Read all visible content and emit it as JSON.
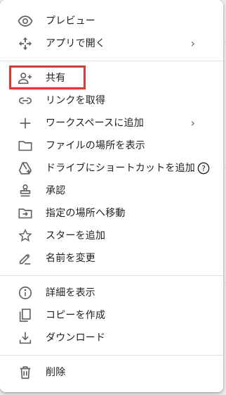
{
  "menu": {
    "group1": [
      {
        "label": "プレビュー",
        "icon": "eye-icon"
      },
      {
        "label": "アプリで開く",
        "icon": "move-arrows-icon",
        "submenu": true
      }
    ],
    "group2": [
      {
        "label": "共有",
        "icon": "person-add-icon"
      },
      {
        "label": "リンクを取得",
        "icon": "link-icon"
      },
      {
        "label": "ワークスペースに追加",
        "icon": "plus-icon",
        "submenu": true
      },
      {
        "label": "ファイルの場所を表示",
        "icon": "folder-icon"
      },
      {
        "label": "ドライブにショートカットを追加",
        "icon": "drive-shortcut-icon",
        "help": "?"
      },
      {
        "label": "承認",
        "icon": "stamp-icon"
      },
      {
        "label": "指定の場所へ移動",
        "icon": "folder-move-icon"
      },
      {
        "label": "スターを追加",
        "icon": "star-icon"
      },
      {
        "label": "名前を変更",
        "icon": "pencil-icon"
      }
    ],
    "group3": [
      {
        "label": "詳細を表示",
        "icon": "info-icon"
      },
      {
        "label": "コピーを作成",
        "icon": "copy-icon"
      },
      {
        "label": "ダウンロード",
        "icon": "download-icon"
      }
    ],
    "group4": [
      {
        "label": "削除",
        "icon": "trash-icon"
      }
    ]
  },
  "colors": {
    "highlight": "#e8362c",
    "icon": "#5f6368",
    "text": "#202124"
  }
}
